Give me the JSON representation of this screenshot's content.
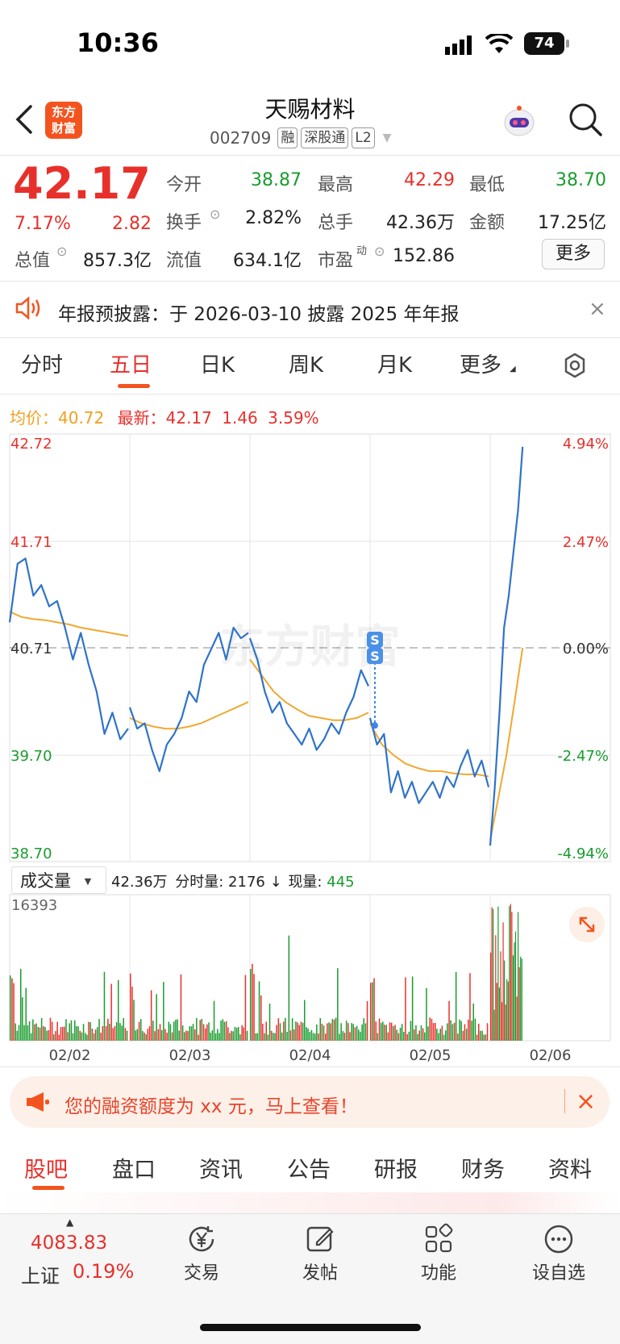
{
  "status_bar": {
    "time": "10:36",
    "battery": "74"
  },
  "header": {
    "title": "天赐材料",
    "code": "002709",
    "tags": [
      "融",
      "深股通",
      "L2"
    ],
    "logo_line1": "东方",
    "logo_line2": "财富"
  },
  "quote": {
    "price": "42.17",
    "change_pct": "7.17%",
    "change": "2.82",
    "open_label": "今开",
    "open": "38.87",
    "high_label": "最高",
    "high": "42.29",
    "low_label": "最低",
    "low": "38.70",
    "turnover_label": "换手",
    "turnover": "2.82%",
    "volume_label": "总手",
    "volume": "42.36万",
    "amount_label": "金额",
    "amount": "17.25亿",
    "mktcap_label": "总值",
    "mktcap": "857.3亿",
    "float_label": "流值",
    "float": "634.1亿",
    "pe_label": "市盈",
    "pe_sup": "动",
    "pe": "152.86",
    "more_button": "更多"
  },
  "notice": {
    "text": "年报预披露：于 2026-03-10 披露 2025 年年报"
  },
  "chart_tabs": [
    "分时",
    "五日",
    "日K",
    "周K",
    "月K",
    "更多"
  ],
  "active_chart_tab": 1,
  "legend": {
    "avg_label": "均价：",
    "avg": "40.72",
    "latest_label": "最新：",
    "latest": "42.17",
    "latest_change": "1.46",
    "latest_pct": "3.59%"
  },
  "volume_header": {
    "selector": "成交量",
    "total": "42.36万",
    "tick_label": "分时量: 2176",
    "arrow": "↓",
    "now_label": "现量:",
    "now": "445",
    "max": "16393"
  },
  "chart_data": {
    "type": "line",
    "series": [],
    "y_left_ticks": [
      "42.72",
      "41.71",
      "40.71",
      "39.70",
      "38.70"
    ],
    "y_right_ticks": [
      "4.94%",
      "2.47%",
      "0.00%",
      "-2.47%",
      "-4.94%"
    ],
    "ylim": [
      38.7,
      42.72
    ],
    "baseline": 40.71,
    "x_ticks": [
      "02/02",
      "02/03",
      "02/04",
      "02/05",
      "02/06"
    ],
    "days": [
      {
        "price": [
          40.95,
          41.5,
          41.55,
          41.2,
          41.3,
          41.1,
          41.15,
          40.9,
          40.6,
          40.85,
          40.55,
          40.3,
          39.9,
          40.1,
          39.85,
          39.95
        ],
        "avg": [
          41.05,
          41.0,
          40.98,
          40.97,
          40.95,
          40.93,
          40.9,
          40.88,
          40.86,
          40.84,
          40.82
        ]
      },
      {
        "price": [
          40.15,
          39.95,
          40.0,
          39.75,
          39.55,
          39.8,
          39.9,
          40.05,
          40.3,
          40.2,
          40.55,
          40.7,
          40.85,
          40.6,
          40.9,
          40.8,
          40.85
        ],
        "avg": [
          40.05,
          40.0,
          39.97,
          39.95,
          39.95,
          39.97,
          40.0,
          40.05,
          40.1,
          40.15,
          40.2
        ]
      },
      {
        "price": [
          40.8,
          40.6,
          40.3,
          40.1,
          40.2,
          40.0,
          39.9,
          39.8,
          39.95,
          39.75,
          39.85,
          40.0,
          39.9,
          40.1,
          40.25,
          40.5,
          40.35
        ],
        "avg": [
          40.6,
          40.45,
          40.3,
          40.2,
          40.13,
          40.07,
          40.05,
          40.03,
          40.03,
          40.05,
          40.1
        ]
      },
      {
        "price": [
          40.05,
          39.8,
          39.9,
          39.35,
          39.55,
          39.3,
          39.45,
          39.25,
          39.35,
          39.45,
          39.3,
          39.5,
          39.4,
          39.6,
          39.75,
          39.5,
          39.65,
          39.4
        ],
        "avg": [
          40.0,
          39.8,
          39.7,
          39.62,
          39.58,
          39.55,
          39.55,
          39.53,
          39.52,
          39.52,
          39.5
        ]
      },
      {
        "price": [
          38.85,
          39.4,
          40.1,
          40.9,
          41.2,
          41.6,
          42.0,
          42.6
        ],
        "avg": [
          38.9,
          39.3,
          39.7,
          40.2,
          40.71
        ]
      }
    ],
    "signal": "S"
  },
  "volume_data": {
    "max": 16393
  },
  "ad_banner": {
    "text": "您的融资额度为 xx 元，马上查看！"
  },
  "bottom_tabs": [
    "股吧",
    "盘口",
    "资讯",
    "公告",
    "研报",
    "财务",
    "资料"
  ],
  "active_bottom_tab": 0,
  "bottom_nav": {
    "index_value": "4083.83",
    "index_name": "上证",
    "index_pct": "0.19%",
    "items": [
      "交易",
      "发帖",
      "功能",
      "设自选"
    ]
  },
  "colors": {
    "up": "#e8302b",
    "down": "#1a9c2e",
    "price_line": "#2f73c9",
    "avg_line": "#f0a830",
    "accent": "#f3541f"
  }
}
